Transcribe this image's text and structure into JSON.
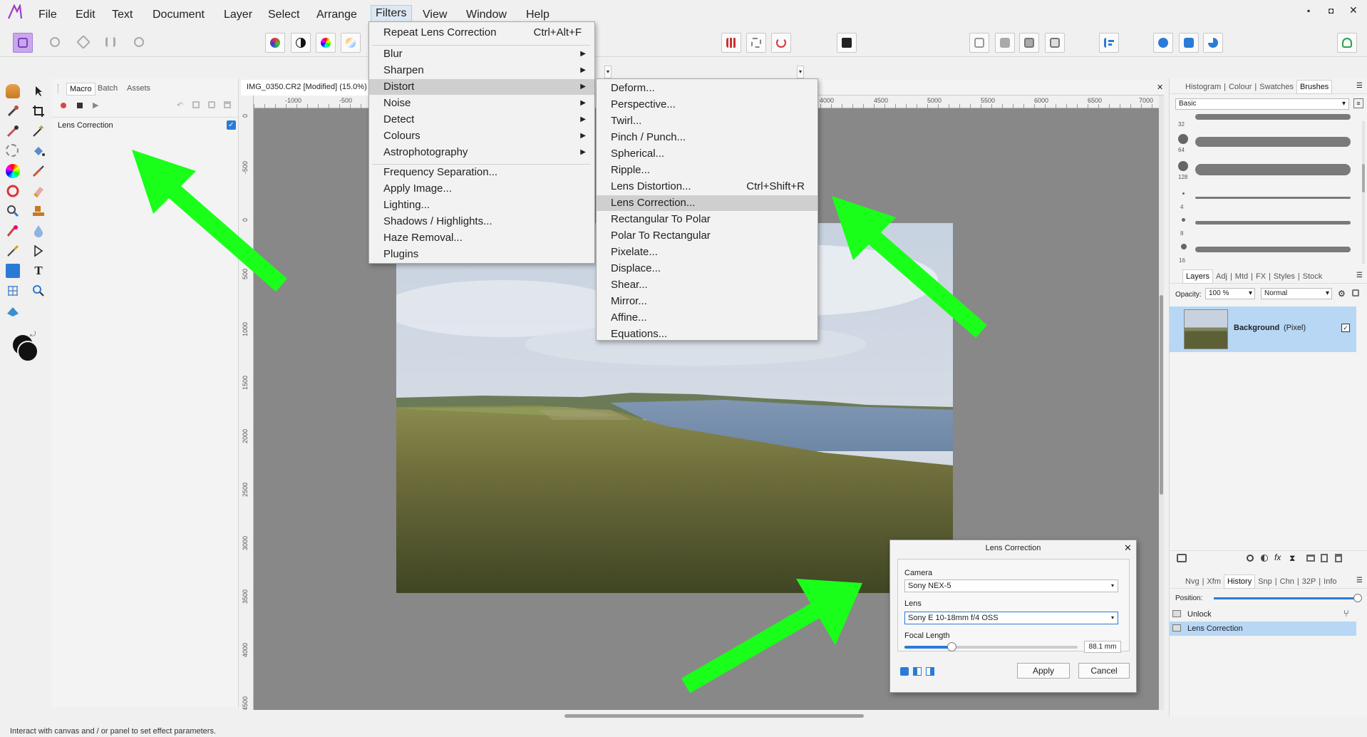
{
  "menubar": {
    "items": [
      "File",
      "Edit",
      "Text",
      "Document",
      "Layer",
      "Select",
      "Arrange",
      "Filters",
      "View",
      "Window",
      "Help"
    ],
    "active": "Filters"
  },
  "window_controls": {
    "minimize": "▪",
    "restore": "◘",
    "close": "✕"
  },
  "left_panel": {
    "tabs": [
      "Macro",
      "Batch",
      "Assets"
    ],
    "active_tab": "Macro",
    "macro_item": "Lens Correction",
    "macro_checked": true
  },
  "document": {
    "tab_title": "IMG_0350.CR2 [Modified] (15.0%)",
    "close": "✕",
    "hruler_labels": [
      "-1000",
      "-500",
      "4000",
      "4500",
      "5000",
      "5500",
      "6000",
      "6500",
      "7000"
    ],
    "vruler_labels": [
      "0",
      "-500",
      "0",
      "500",
      "1000",
      "1500",
      "2000",
      "2500",
      "3000",
      "3500",
      "4000",
      "4500"
    ]
  },
  "filters_menu": {
    "items": [
      {
        "label": "Repeat Lens Correction",
        "shortcut": "Ctrl+Alt+F"
      },
      {
        "label": "Blur",
        "submenu": true
      },
      {
        "label": "Sharpen",
        "submenu": true
      },
      {
        "label": "Distort",
        "submenu": true,
        "highlighted": true
      },
      {
        "label": "Noise",
        "submenu": true
      },
      {
        "label": "Detect",
        "submenu": true
      },
      {
        "label": "Colours",
        "submenu": true
      },
      {
        "label": "Astrophotography",
        "submenu": true
      },
      {
        "label": "Frequency Separation..."
      },
      {
        "label": "Apply Image..."
      },
      {
        "label": "Lighting..."
      },
      {
        "label": "Shadows / Highlights..."
      },
      {
        "label": "Haze Removal..."
      },
      {
        "label": "Plugins"
      }
    ]
  },
  "distort_menu": {
    "items": [
      {
        "label": "Deform..."
      },
      {
        "label": "Perspective..."
      },
      {
        "label": "Twirl..."
      },
      {
        "label": "Pinch / Punch..."
      },
      {
        "label": "Spherical..."
      },
      {
        "label": "Ripple..."
      },
      {
        "label": "Lens Distortion...",
        "shortcut": "Ctrl+Shift+R"
      },
      {
        "label": "Lens Correction...",
        "highlighted": true
      },
      {
        "label": "Rectangular To Polar"
      },
      {
        "label": "Polar To Rectangular"
      },
      {
        "label": "Pixelate..."
      },
      {
        "label": "Displace..."
      },
      {
        "label": "Shear..."
      },
      {
        "label": "Mirror..."
      },
      {
        "label": "Affine..."
      },
      {
        "label": "Equations..."
      }
    ]
  },
  "right_panel": {
    "top_tabs": [
      "Histogram",
      "Colour",
      "Swatches",
      "Brushes"
    ],
    "top_active": "Brushes",
    "brush_category": "Basic",
    "brush_sizes": [
      "32",
      "64",
      "128",
      "4",
      "8",
      "16"
    ],
    "layers_tabs": [
      "Layers",
      "Adj",
      "Mtd",
      "FX",
      "Styles",
      "Stock"
    ],
    "layers_active": "Layers",
    "opacity_label": "Opacity:",
    "opacity_value": "100 %",
    "blend_mode": "Normal",
    "layer_name": "Background",
    "layer_type": "(Pixel)",
    "history_tabs": [
      "Nvg",
      "Xfm",
      "History",
      "Snp",
      "Chn",
      "32P",
      "Info"
    ],
    "history_active": "History",
    "position_label": "Position:",
    "history_items": [
      "Unlock",
      "Lens Correction"
    ]
  },
  "dialog": {
    "title": "Lens Correction",
    "close": "✕",
    "camera_label": "Camera",
    "camera_value": "Sony NEX-5",
    "lens_label": "Lens",
    "lens_value": "Sony E 10-18mm f/4 OSS",
    "focal_label": "Focal Length",
    "focal_value": "88.1 mm",
    "focal_slider": 0.27,
    "apply": "Apply",
    "cancel": "Cancel"
  },
  "status_text": "Interact with canvas and / or panel to set effect parameters.",
  "colors": {
    "accent": "#2b7bd6",
    "highlight_arrow": "#1aff1a",
    "selection": "#b7d7f5"
  }
}
